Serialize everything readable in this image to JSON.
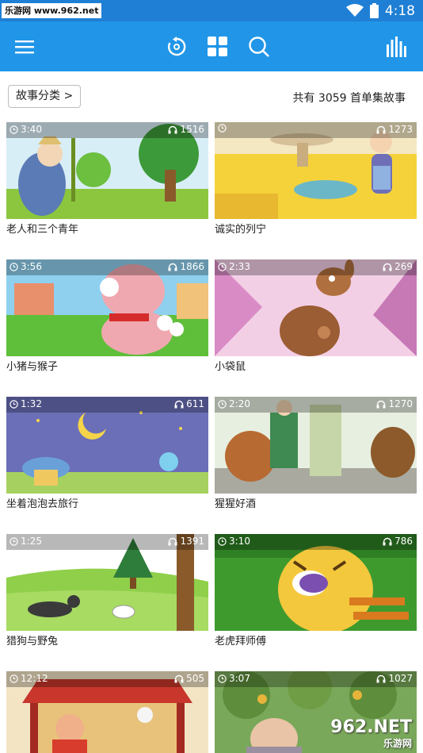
{
  "status_bar": {
    "watermark": "乐游网 www.962.net",
    "time": "4:18"
  },
  "toolbar": {
    "icons": [
      "menu-icon",
      "replay-icon",
      "grid-icon",
      "search-icon",
      "equalizer-icon"
    ]
  },
  "header": {
    "category_button": "故事分类 >",
    "count_text": "共有 3059 首单集故事"
  },
  "stories": [
    {
      "title": "老人和三个青年",
      "duration": "3:40",
      "plays": "1516"
    },
    {
      "title": "诚实的列宁",
      "duration": "",
      "plays": "1273"
    },
    {
      "title": "小猪与猴子",
      "duration": "3:56",
      "plays": "1866"
    },
    {
      "title": "小袋鼠",
      "duration": "2:33",
      "plays": "269"
    },
    {
      "title": "坐着泡泡去旅行",
      "duration": "1:32",
      "plays": "611"
    },
    {
      "title": "猩猩好酒",
      "duration": "2:20",
      "plays": "1270"
    },
    {
      "title": "猎狗与野兔",
      "duration": "1:25",
      "plays": "1391"
    },
    {
      "title": "老虎拜师傅",
      "duration": "3:10",
      "plays": "786"
    },
    {
      "title": "",
      "duration": "12:12",
      "plays": "505"
    },
    {
      "title": "",
      "duration": "3:07",
      "plays": "1027"
    }
  ],
  "brand_logo": {
    "text": "962.NET",
    "subtext": "乐游网"
  },
  "colors": {
    "status_bar": "#1f7fd4",
    "toolbar": "#2196e8"
  }
}
